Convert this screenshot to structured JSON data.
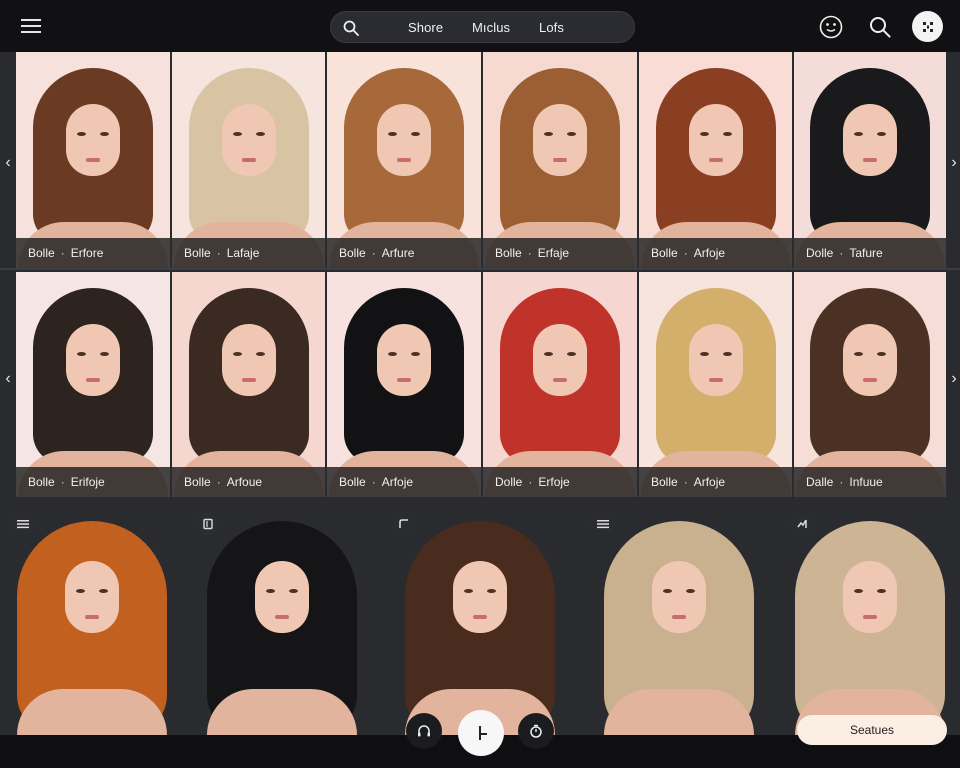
{
  "topbar": {
    "tabs": [
      "Shore",
      "Mıclus",
      "Lofs"
    ]
  },
  "gallery": {
    "row1": [
      {
        "name": "Bolle",
        "style": "Erfore",
        "hair": "#6b3a22",
        "bg": "#f7e1dc"
      },
      {
        "name": "Bolle",
        "style": "Lafaje",
        "hair": "#d8c4a3",
        "bg": "#f6e4de"
      },
      {
        "name": "Bolle",
        "style": "Arfure",
        "hair": "#a8693a",
        "bg": "#f8e2da"
      },
      {
        "name": "Bolle",
        "style": "Erfaje",
        "hair": "#9b5f33",
        "bg": "#f6d9d0"
      },
      {
        "name": "Bolle",
        "style": "Arfoje",
        "hair": "#8a3f22",
        "bg": "#f8dcd5"
      },
      {
        "name": "Dolle",
        "style": "Tafure",
        "hair": "#1a1a1c",
        "bg": "#f4dcd8"
      }
    ],
    "row2": [
      {
        "name": "Bolle",
        "style": "Erifoje",
        "hair": "#2e241f",
        "bg": "#f6e6e3"
      },
      {
        "name": "Bolle",
        "style": "Arfoue",
        "hair": "#3a2a22",
        "bg": "#f6d7d0"
      },
      {
        "name": "Bolle",
        "style": "Arfoje",
        "hair": "#121214",
        "bg": "#f7e2df"
      },
      {
        "name": "Dolle",
        "style": "Erfoje",
        "hair": "#c0332a",
        "bg": "#f5d6d1"
      },
      {
        "name": "Bolle",
        "style": "Arfoje",
        "hair": "#d4ae6b",
        "bg": "#f7e4dd"
      },
      {
        "name": "Dalle",
        "style": "Infuue",
        "hair": "#4a3123",
        "bg": "#f6ddd7"
      }
    ],
    "row3": [
      {
        "hair": "#c2601f",
        "bg": "#f7e0dc"
      },
      {
        "hair": "#151517",
        "bg": "#f8e5e2"
      },
      {
        "hair": "#4a2c1e",
        "bg": "#f7dfdb"
      },
      {
        "hair": "#c9b08f",
        "bg": "#f4e5e1"
      },
      {
        "hair": "#cdb495",
        "bg": "#f6dfdb"
      }
    ]
  },
  "bottombar": {
    "status_label": "Seatues"
  }
}
